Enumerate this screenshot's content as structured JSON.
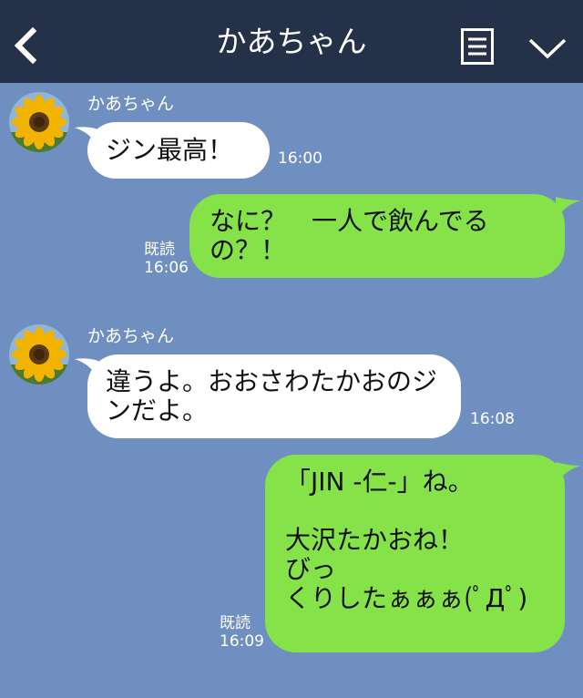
{
  "header": {
    "title": "かあちゃん",
    "back_icon": "chevron-left-icon",
    "menu_icon": "document-menu-icon",
    "collapse_icon": "chevron-down-icon",
    "background": "#253148"
  },
  "chat": {
    "background": "#6f8fc1",
    "incoming_bubble_color": "#ffffff",
    "outgoing_bubble_color": "#85e249",
    "messages": [
      {
        "direction": "incoming",
        "sender": "かあちゃん",
        "avatar": "sunflower-avatar",
        "text": "ジン最高！",
        "time": "16:00"
      },
      {
        "direction": "outgoing",
        "text": "なに？　一人で飲んでるの？！",
        "read": "既読",
        "time": "16:06"
      },
      {
        "direction": "incoming",
        "sender": "かあちゃん",
        "avatar": "sunflower-avatar",
        "text": "違うよ。おおさわたかおのジンだよ。",
        "time": "16:08"
      },
      {
        "direction": "outgoing",
        "text": "「JIN -仁-」ね。\n\n大沢たかおね！\nびっ\nくりしたぁぁぁ(ﾟДﾟ)",
        "read": "既読",
        "time": "16:09"
      }
    ]
  }
}
